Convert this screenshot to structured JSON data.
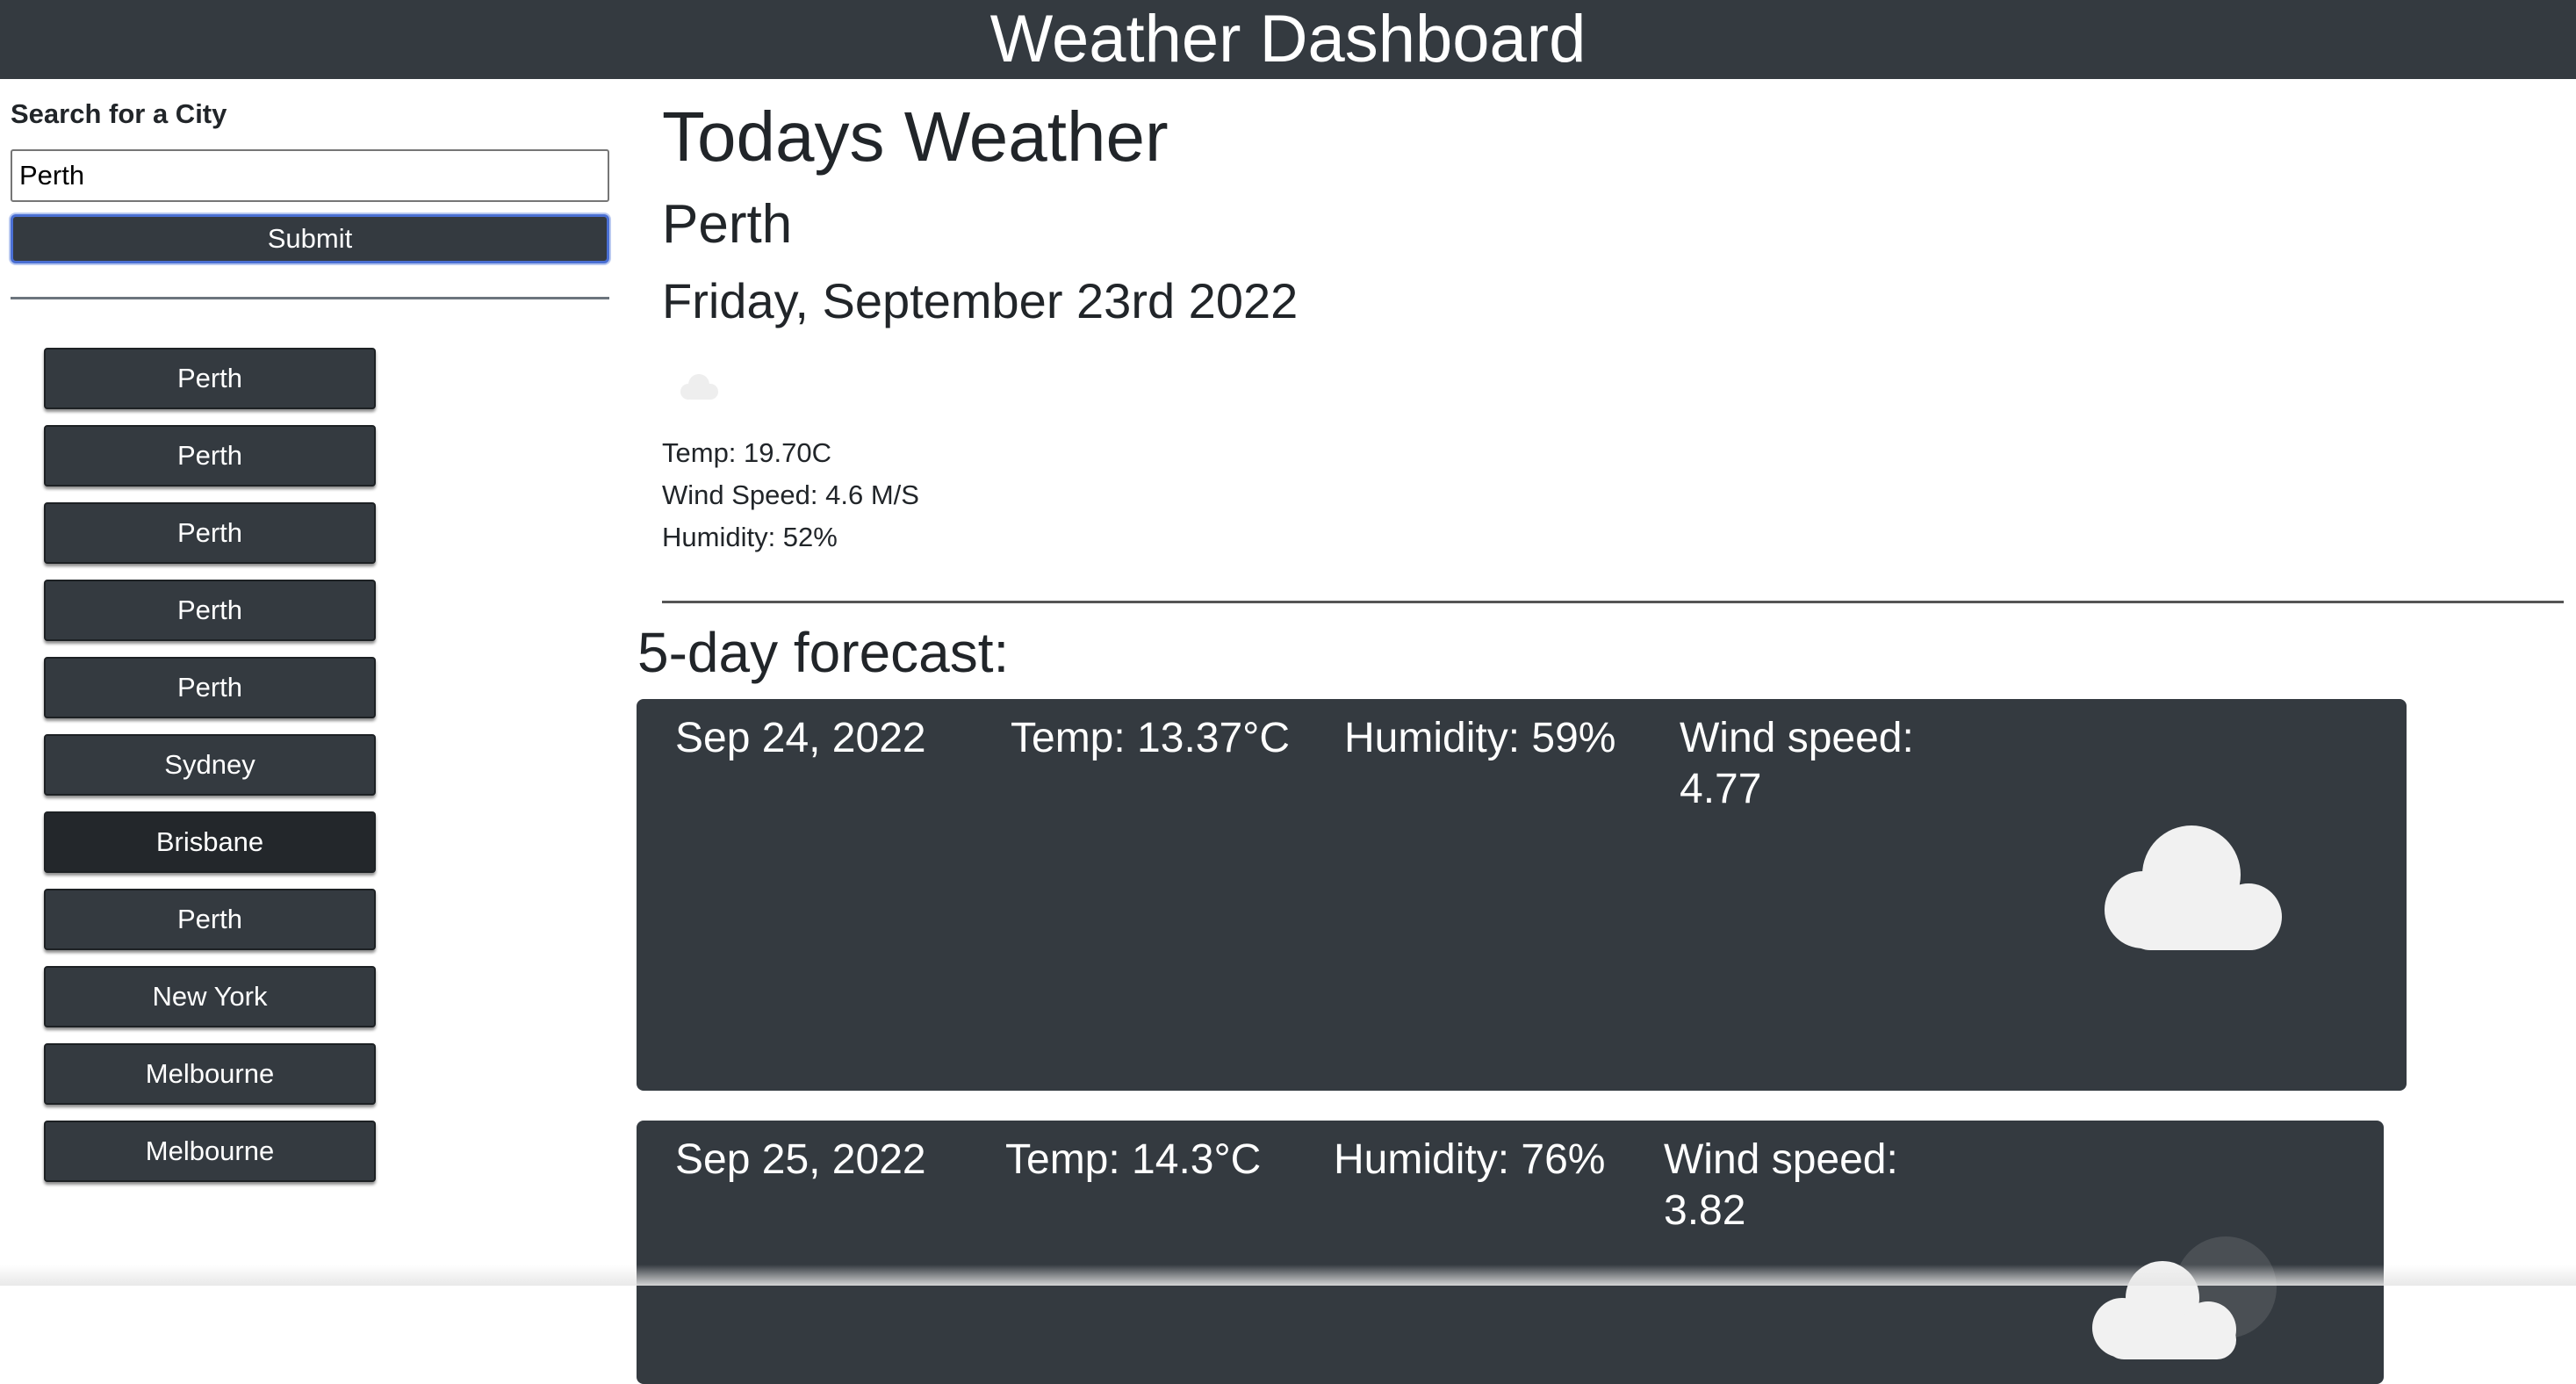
{
  "header": {
    "title": "Weather Dashboard"
  },
  "sidebar": {
    "search_label": "Search for a City",
    "search_value": "Perth",
    "submit_label": "Submit",
    "history": [
      {
        "label": "Perth"
      },
      {
        "label": "Perth"
      },
      {
        "label": "Perth"
      },
      {
        "label": "Perth"
      },
      {
        "label": "Perth"
      },
      {
        "label": "Sydney"
      },
      {
        "label": "Brisbane"
      },
      {
        "label": "Perth"
      },
      {
        "label": "New York"
      },
      {
        "label": "Melbourne"
      },
      {
        "label": "Melbourne"
      }
    ]
  },
  "today": {
    "heading": "Todays Weather",
    "city": "Perth",
    "date": "Friday, September 23rd 2022",
    "icon": "cloud-icon",
    "temp": "Temp: 19.70C",
    "wind": "Wind Speed: 4.6 M/S",
    "humidity": "Humidity: 52%"
  },
  "forecast": {
    "title": "5-day forecast:",
    "cards": [
      {
        "date": "Sep 24, 2022",
        "temp": "Temp: 13.37°C",
        "humidity": "Humidity: 59%",
        "wind": "Wind speed: 4.77",
        "icon": "cloud-icon"
      },
      {
        "date": "Sep 25, 2022",
        "temp": "Temp: 14.3°C",
        "humidity": "Humidity: 76%",
        "wind": "Wind speed: 3.82",
        "icon": "cloudy-icon"
      }
    ]
  },
  "colors": {
    "dark": "#343a40",
    "focus_border": "#4a6fd3",
    "cloud": "#f1f1f1"
  }
}
